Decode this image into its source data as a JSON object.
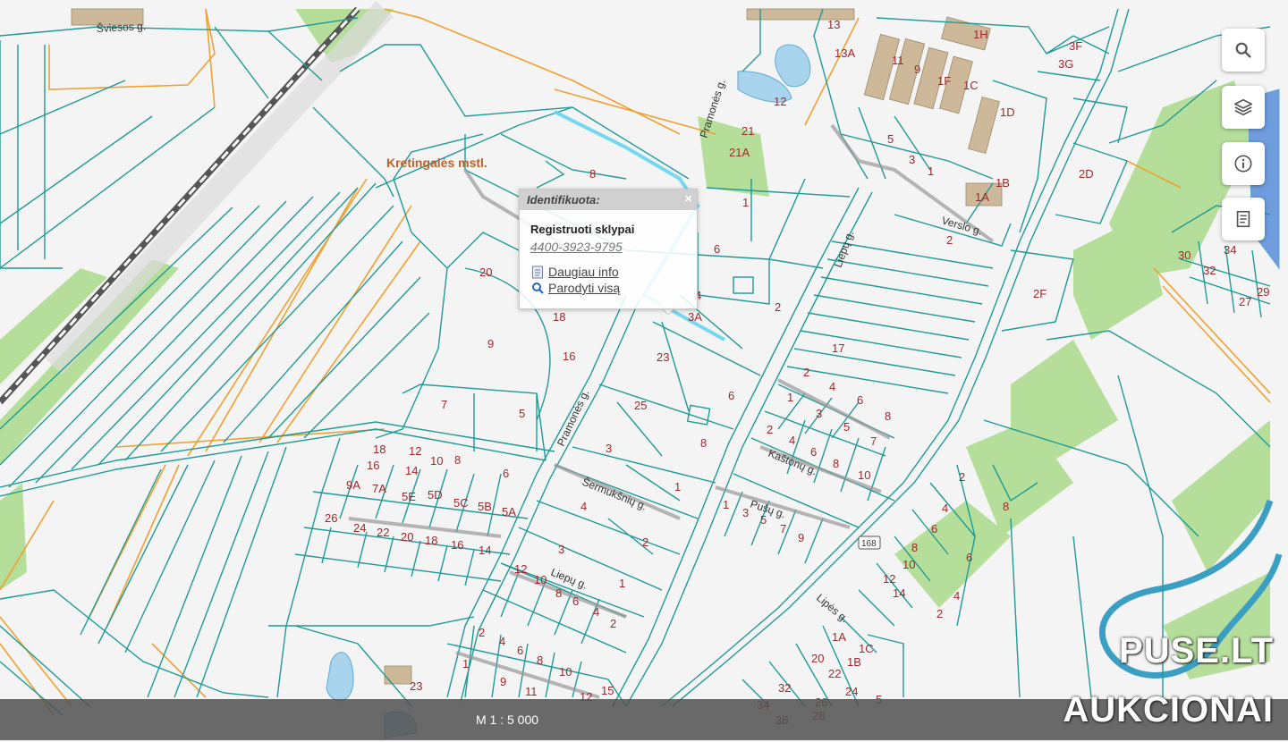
{
  "map": {
    "town_label": "Kretingalės mstl.",
    "streets": [
      "Šviesos g.",
      "Pramonės g.",
      "Pramonės g.",
      "Verslo g.",
      "Liepų g.",
      "Šermukšnių g.",
      "Pušų g.",
      "Kaštonų g.",
      "Liepų g.",
      "Lipės g.",
      "168"
    ],
    "parcel_numbers": [
      "12",
      "13",
      "13A",
      "11",
      "9",
      "1F",
      "1C",
      "1H",
      "3F",
      "3G",
      "21",
      "21A",
      "5",
      "3",
      "1",
      "1D",
      "1B",
      "1A",
      "2D",
      "8",
      "1",
      "2",
      "6",
      "20",
      "18",
      "9",
      "16",
      "7",
      "5",
      "23",
      "25",
      "6",
      "4",
      "2",
      "3A",
      "17",
      "2",
      "4",
      "6",
      "8",
      "1",
      "3",
      "5",
      "7",
      "2",
      "4",
      "6",
      "8",
      "10",
      "3",
      "8",
      "1",
      "4",
      "2",
      "3",
      "1",
      "18",
      "12",
      "10",
      "8",
      "16",
      "14",
      "9A",
      "7A",
      "5E",
      "5D",
      "5C",
      "5B",
      "5A",
      "6",
      "26",
      "24",
      "22",
      "20",
      "18",
      "16",
      "14",
      "12",
      "10",
      "8",
      "6",
      "4",
      "2",
      "1",
      "3",
      "5",
      "7",
      "9",
      "2",
      "4",
      "6",
      "8",
      "10",
      "12",
      "14",
      "2F",
      "30",
      "32",
      "34",
      "29",
      "27",
      "6",
      "4",
      "2",
      "8",
      "1A",
      "1C",
      "20",
      "1B",
      "22",
      "24",
      "32",
      "34",
      "36",
      "28",
      "26",
      "23",
      "2",
      "4",
      "6",
      "8",
      "10",
      "12",
      "15",
      "1",
      "9",
      "11",
      "5"
    ]
  },
  "controls": {
    "search": "search-icon",
    "layers": "layers-icon",
    "info": "info-icon",
    "legend": "legend-icon"
  },
  "popup": {
    "header": "Identifikuota:",
    "close": "×",
    "title": "Registruoti sklypai",
    "code": "4400-3923-9795",
    "more_info": "Daugiau info",
    "show_all": "Parodyti visą"
  },
  "scale": "M 1 : 5 000",
  "watermark": [
    "PUSE.LT",
    "AUKCIONAI"
  ],
  "colors": {
    "parcel_line": "#1f9a96",
    "boundary_line": "#f0a030",
    "highlight": "#5fd2ee",
    "label": "#a0282c"
  }
}
